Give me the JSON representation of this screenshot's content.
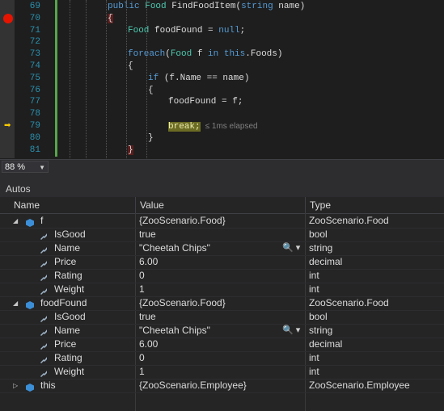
{
  "editor": {
    "lines": [
      {
        "num": "69",
        "indent": 0,
        "parts": [
          {
            "t": "public ",
            "c": "kw"
          },
          {
            "t": "Food ",
            "c": "ty"
          },
          {
            "t": "FindFoodItem(",
            "c": ""
          },
          {
            "t": "string ",
            "c": "kw"
          },
          {
            "t": "name)",
            "c": ""
          }
        ]
      },
      {
        "num": "70",
        "indent": 0,
        "parts": [
          {
            "t": "{",
            "c": "brace-hl"
          }
        ]
      },
      {
        "num": "71",
        "indent": 1,
        "parts": [
          {
            "t": "Food ",
            "c": "ty"
          },
          {
            "t": "foodFound = ",
            "c": ""
          },
          {
            "t": "null",
            "c": "kw"
          },
          {
            "t": ";",
            "c": ""
          }
        ]
      },
      {
        "num": "72",
        "indent": 0,
        "parts": []
      },
      {
        "num": "73",
        "indent": 1,
        "parts": [
          {
            "t": "foreach",
            "c": "kw"
          },
          {
            "t": "(",
            "c": ""
          },
          {
            "t": "Food ",
            "c": "ty"
          },
          {
            "t": "f ",
            "c": ""
          },
          {
            "t": "in ",
            "c": "kw"
          },
          {
            "t": "this",
            "c": "kw"
          },
          {
            "t": ".Foods)",
            "c": ""
          }
        ]
      },
      {
        "num": "74",
        "indent": 1,
        "parts": [
          {
            "t": "{",
            "c": ""
          }
        ]
      },
      {
        "num": "75",
        "indent": 2,
        "parts": [
          {
            "t": "if ",
            "c": "kw"
          },
          {
            "t": "(f.Name == name)",
            "c": ""
          }
        ]
      },
      {
        "num": "76",
        "indent": 2,
        "parts": [
          {
            "t": "{",
            "c": ""
          }
        ]
      },
      {
        "num": "77",
        "indent": 3,
        "parts": [
          {
            "t": "foodFound = f;",
            "c": ""
          }
        ]
      },
      {
        "num": "78",
        "indent": 0,
        "parts": []
      },
      {
        "num": "79",
        "indent": 3,
        "parts": [
          {
            "t": "break;",
            "c": "break-hl"
          }
        ],
        "elapsed": "≤ 1ms elapsed"
      },
      {
        "num": "80",
        "indent": 2,
        "parts": [
          {
            "t": "}",
            "c": ""
          }
        ]
      },
      {
        "num": "81",
        "indent": 1,
        "parts": [
          {
            "t": "}",
            "c": "brace-hl"
          }
        ]
      }
    ]
  },
  "zoom": {
    "value": "88 %"
  },
  "autos": {
    "title": "Autos",
    "columns": {
      "name": "Name",
      "value": "Value",
      "type": "Type"
    },
    "rows": [
      {
        "level": 0,
        "expander": "down",
        "name": "f",
        "value": "{ZooScenario.Food}",
        "type": "ZooScenario.Food",
        "icon": "object"
      },
      {
        "level": 1,
        "expander": "",
        "name": "IsGood",
        "value": "true",
        "type": "bool",
        "icon": "property"
      },
      {
        "level": 1,
        "expander": "",
        "name": "Name",
        "value": "\"Cheetah Chips\"",
        "type": "string",
        "icon": "property",
        "viewer": "🔍 ▾"
      },
      {
        "level": 1,
        "expander": "",
        "name": "Price",
        "value": "6.00",
        "type": "decimal",
        "icon": "property"
      },
      {
        "level": 1,
        "expander": "",
        "name": "Rating",
        "value": "0",
        "type": "int",
        "icon": "property"
      },
      {
        "level": 1,
        "expander": "",
        "name": "Weight",
        "value": "1",
        "type": "int",
        "icon": "property"
      },
      {
        "level": 0,
        "expander": "down",
        "name": "foodFound",
        "value": "{ZooScenario.Food}",
        "type": "ZooScenario.Food",
        "icon": "object"
      },
      {
        "level": 1,
        "expander": "",
        "name": "IsGood",
        "value": "true",
        "type": "bool",
        "icon": "property"
      },
      {
        "level": 1,
        "expander": "",
        "name": "Name",
        "value": "\"Cheetah Chips\"",
        "type": "string",
        "icon": "property",
        "viewer": "🔍 ▾"
      },
      {
        "level": 1,
        "expander": "",
        "name": "Price",
        "value": "6.00",
        "type": "decimal",
        "icon": "property"
      },
      {
        "level": 1,
        "expander": "",
        "name": "Rating",
        "value": "0",
        "type": "int",
        "icon": "property"
      },
      {
        "level": 1,
        "expander": "",
        "name": "Weight",
        "value": "1",
        "type": "int",
        "icon": "property"
      },
      {
        "level": 0,
        "expander": "right",
        "name": "this",
        "value": "{ZooScenario.Employee}",
        "type": "ZooScenario.Employee",
        "icon": "object"
      }
    ]
  },
  "colors": {
    "object_icon": "#3c8fd6",
    "property_icon": "#9fb4c8",
    "breakpoint": "#e51400",
    "current_line_arrow": "#ffcc00"
  }
}
